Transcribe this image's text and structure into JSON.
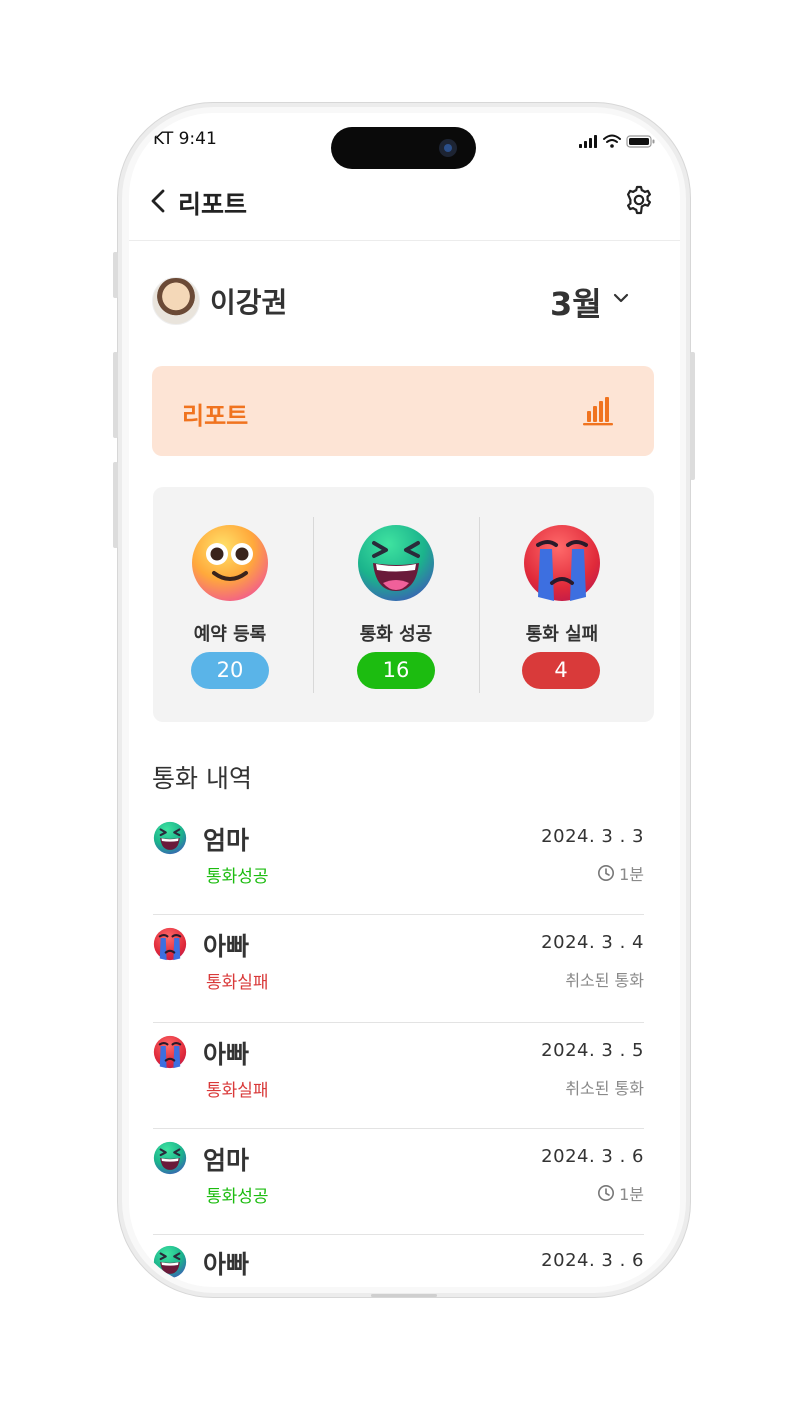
{
  "status_bar": {
    "carrier_time": "KT 9:41"
  },
  "nav": {
    "title": "리포트"
  },
  "profile": {
    "name": "이강권",
    "month": "3월"
  },
  "report_banner": {
    "label": "리포트"
  },
  "stats": [
    {
      "label": "예약 등록",
      "value": "20",
      "emoji": "smiling-face-icon",
      "color": "#5ab4e8"
    },
    {
      "label": "통화 성공",
      "value": "16",
      "emoji": "laughing-face-icon",
      "color": "#1cbc10"
    },
    {
      "label": "통화 실패",
      "value": "4",
      "emoji": "crying-face-icon",
      "color": "#d93a3a"
    }
  ],
  "history": {
    "title": "통화 내역",
    "rows": [
      {
        "name": "엄마",
        "status": "통화성공",
        "date": "2024.  3 . 3",
        "meta": "1분",
        "result": "success"
      },
      {
        "name": "아빠",
        "status": "통화실패",
        "date": "2024.  3 . 4",
        "meta": "취소된 통화",
        "result": "fail"
      },
      {
        "name": "아빠",
        "status": "통화실패",
        "date": "2024.  3 . 5",
        "meta": "취소된 통화",
        "result": "fail"
      },
      {
        "name": "엄마",
        "status": "통화성공",
        "date": "2024.  3 . 6",
        "meta": "1분",
        "result": "success"
      },
      {
        "name": "아빠",
        "status": "",
        "date": "2024.  3 . 6",
        "meta": "",
        "result": "success"
      }
    ]
  },
  "colors": {
    "accent_orange": "#f0731f",
    "banner_bg": "#fde4d5",
    "success": "#1cbc10",
    "fail": "#d93a3a"
  }
}
